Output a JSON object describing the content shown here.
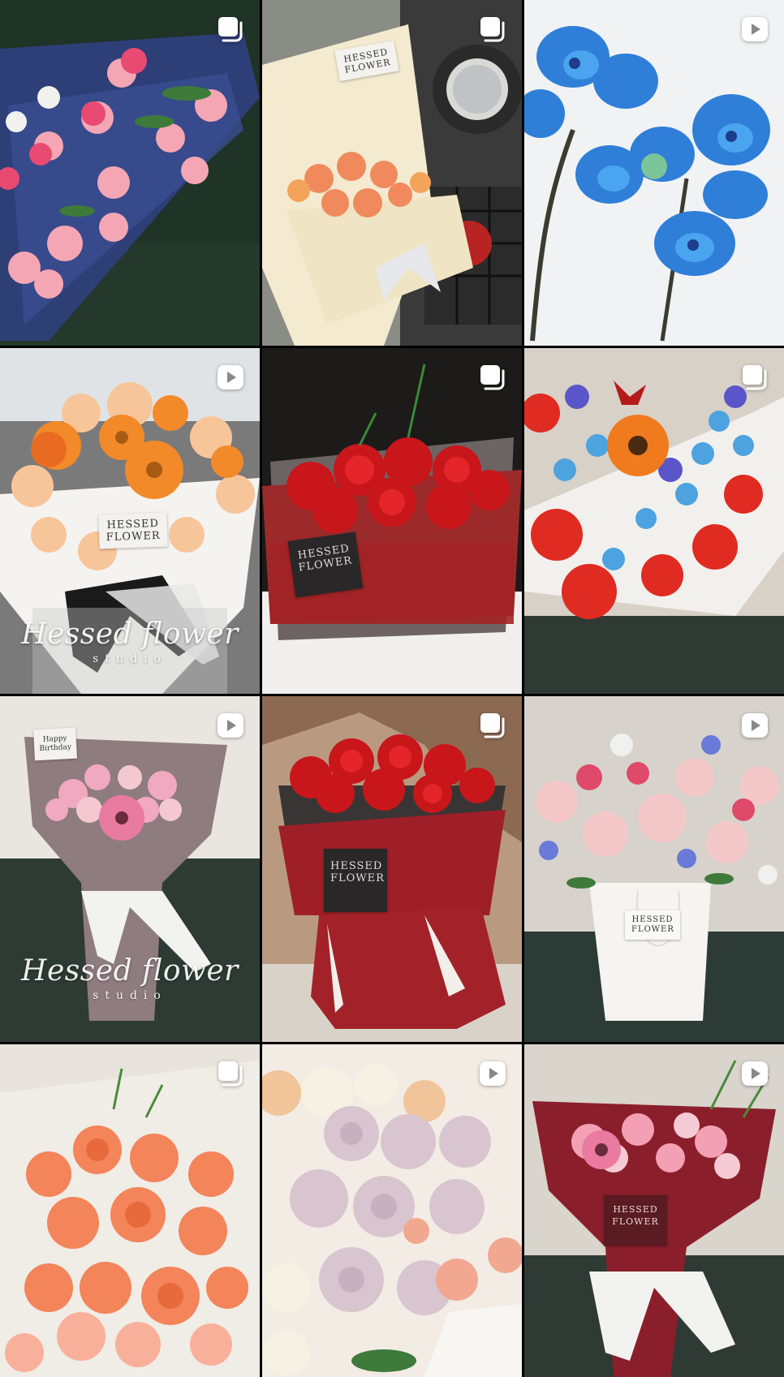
{
  "grid": {
    "tiles": [
      {
        "kind": "carousel",
        "badge_icon": "carousel-icon",
        "colors": [
          "#1f3326",
          "#2f3f7a",
          "#f4a6b4"
        ]
      },
      {
        "kind": "carousel",
        "badge_icon": "carousel-icon",
        "colors": [
          "#8a8c86",
          "#f3ead0",
          "#f08a5d"
        ],
        "label": "HESSED FLOWER"
      },
      {
        "kind": "reel",
        "badge_icon": "reel-play-icon",
        "colors": [
          "#f1f2f4",
          "#2f7fd8",
          "#4aa4ef"
        ]
      },
      {
        "kind": "reel",
        "badge_icon": "reel-play-icon",
        "colors": [
          "#7a7a7a",
          "#f28a2a",
          "#f7c59a"
        ],
        "label": "HESSED FLOWER",
        "watermark_main": "Hessed flower",
        "watermark_sub": "studio"
      },
      {
        "kind": "carousel",
        "badge_icon": "carousel-icon",
        "colors": [
          "#1d1a1a",
          "#c8161b",
          "#9c2a2a"
        ],
        "label": "HESSED FLOWER"
      },
      {
        "kind": "carousel",
        "badge_icon": "carousel-icon",
        "colors": [
          "#d7d1c7",
          "#e02b22",
          "#4da3e0"
        ]
      },
      {
        "kind": "reel",
        "badge_icon": "reel-play-icon",
        "colors": [
          "#2e3b35",
          "#8f7c7e",
          "#f0a9c1"
        ],
        "label": "Happy Birthday",
        "watermark_main": "Hessed flower",
        "watermark_sub": "studio"
      },
      {
        "kind": "carousel",
        "badge_icon": "carousel-icon",
        "colors": [
          "#b99a80",
          "#c8161b",
          "#9e1f28"
        ],
        "label": "HESSED FLOWER"
      },
      {
        "kind": "reel",
        "badge_icon": "reel-play-icon",
        "colors": [
          "#d7d3cc",
          "#f4c8c8",
          "#e04a6a"
        ],
        "label": "HESSED FLOWER"
      },
      {
        "kind": "carousel",
        "badge_icon": "carousel-icon",
        "colors": [
          "#e8e3dc",
          "#f4845a",
          "#f8b09a"
        ]
      },
      {
        "kind": "reel",
        "badge_icon": "reel-play-icon",
        "colors": [
          "#f2ece4",
          "#d9c5d0",
          "#f2c49a"
        ]
      },
      {
        "kind": "reel",
        "badge_icon": "reel-play-icon",
        "colors": [
          "#d9d4cc",
          "#8a1f2b",
          "#f4a0b4"
        ],
        "label": "HESSED FLOWER"
      }
    ]
  }
}
